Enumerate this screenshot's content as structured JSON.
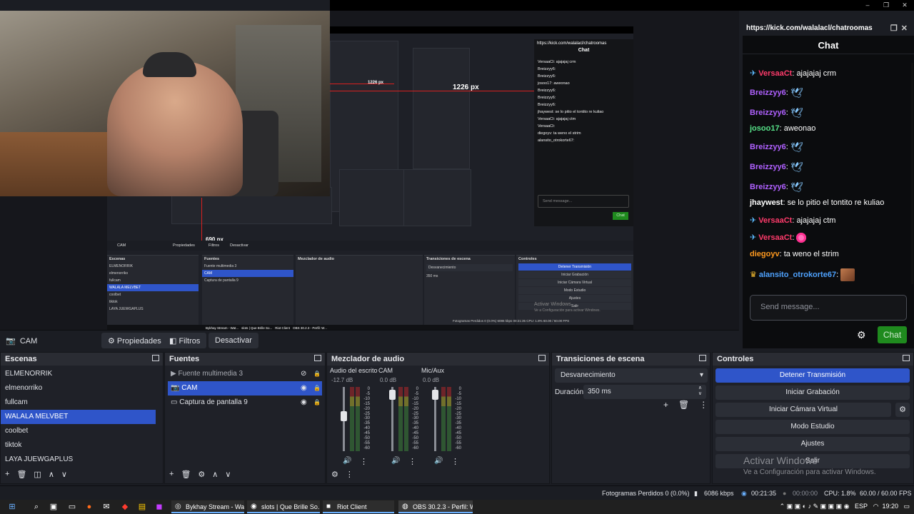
{
  "window": {
    "controls": [
      "–",
      "❐",
      "✕"
    ]
  },
  "preview_overlay": {
    "label_1226": "1226 px",
    "label_690": "690 px",
    "mini_chat_url": "https://kick.com/walalacl/chatroomas",
    "mini_chat_title": "Chat",
    "mini_lines": [
      "VersaaCt: ajajajaj crm",
      "Breizzyy6:",
      "Breizzyy6:",
      "josoo17: aweonao",
      "Breizzyy6:",
      "Breizzyy6:",
      "Breizzyy6:",
      "jhaywest: se lo pitio el tontito re kuliao",
      "VersaaCt: ajajajaj ctm",
      "VersaaCt:",
      "diegoyv: ta weno el strim",
      "alansito_otrokorte67:"
    ],
    "mini_send": "Send message...",
    "mini_chat_btn": "Chat",
    "mini_docks": [
      "Escenas",
      "Fuentes",
      "Mezclador de audio",
      "Transiciones de escena",
      "Controles"
    ],
    "mini_scenes": [
      "ELMENORRIK",
      "elmenorriko",
      "fullcam",
      "WALALA MELVBET",
      "coolbet",
      "tiktok",
      "LAYA JUEWGAPLUS"
    ],
    "mini_sources": [
      "Fuente multimedia 3",
      "CAM",
      "Captura de pantalla 9"
    ],
    "mini_controls": [
      "Detener Transmisión",
      "Iniciar Grabación",
      "Iniciar Cámara Virtual",
      "Modo Estudio",
      "Ajustes",
      "Salir"
    ],
    "mini_trans": "Desvanecimiento",
    "mini_dur": "350 ms",
    "mini_cam": "CAM",
    "mini_props": "Propiedades",
    "mini_filters": "Filtros",
    "mini_deact": "Desactivar",
    "mini_status": "Fotogramas Perdidos 0 (0.0%)   6086 kbps   00:21:35   CPU: 1.8%   60.00 / 60.00 FPS",
    "mini_watermark": "Activar Windows",
    "mini_watermark_sub": "Ve a Configuración para activar Windows.",
    "mini_tasks": [
      "Bykhay Stream - Wat...",
      "slots | Que Brille So...",
      "Riot Client",
      "OBS 30.2.3 - Perfil: W..."
    ]
  },
  "chat": {
    "url": "https://kick.com/walalacl/chatroomas",
    "title": "Chat",
    "messages": [
      {
        "user": "VersaaCt",
        "color": "#ff3b6b",
        "badge": true,
        "text": "ajajajaj crm",
        "emote": ""
      },
      {
        "user": "Breizzyy6",
        "color": "#b061ff",
        "badge": false,
        "text": "",
        "emote": "dove"
      },
      {
        "user": "Breizzyy6",
        "color": "#b061ff",
        "badge": false,
        "text": "",
        "emote": "dove"
      },
      {
        "user": "josoo17",
        "color": "#57e389",
        "badge": false,
        "text": "aweonao",
        "emote": ""
      },
      {
        "user": "Breizzyy6",
        "color": "#b061ff",
        "badge": false,
        "text": "",
        "emote": "dove"
      },
      {
        "user": "Breizzyy6",
        "color": "#b061ff",
        "badge": false,
        "text": "",
        "emote": "dove"
      },
      {
        "user": "Breizzyy6",
        "color": "#b061ff",
        "badge": false,
        "text": "",
        "emote": "dove"
      },
      {
        "user": "jhaywest",
        "color": "#ffffff",
        "badge": false,
        "text": "se lo pitio el tontito re kuliao",
        "emote": ""
      },
      {
        "user": "VersaaCt",
        "color": "#ff3b6b",
        "badge": true,
        "text": "ajajajaj ctm",
        "emote": ""
      },
      {
        "user": "VersaaCt",
        "color": "#ff3b6b",
        "badge": true,
        "text": "",
        "emote": "pink"
      },
      {
        "user": "diegoyv",
        "color": "#ff9a1f",
        "badge": false,
        "text": "ta weno el strim",
        "emote": ""
      },
      {
        "user": "alansito_otrokorte67",
        "color": "#4fa3ff",
        "badge": false,
        "crown": true,
        "text": "",
        "emote": "img"
      }
    ],
    "input_placeholder": "Send message...",
    "send_label": "Chat"
  },
  "source_toolbar": {
    "source_name": "CAM",
    "properties": "Propiedades",
    "filters": "Filtros",
    "deactivate": "Desactivar"
  },
  "docks": {
    "scenes": {
      "title": "Escenas",
      "items": [
        "ELMENORRIK",
        "elmenorriko",
        "fullcam",
        "WALALA MELVBET",
        "coolbet",
        "tiktok",
        "LAYA JUEWGAPLUS"
      ],
      "selected": 3
    },
    "sources": {
      "title": "Fuentes",
      "items": [
        {
          "name": "Fuente multimedia 3",
          "icon": "play-icon"
        },
        {
          "name": "CAM",
          "icon": "camera-icon"
        },
        {
          "name": "Captura de pantalla 9",
          "icon": "monitor-icon"
        }
      ]
    },
    "mixer": {
      "title": "Mezclador de audio",
      "channels": [
        {
          "name": "Audio del escrito",
          "db": "-12.7 dB",
          "level": 0.55
        },
        {
          "name": "CAM",
          "db": "0.0 dB",
          "level": 0.95
        },
        {
          "name": "Mic/Aux",
          "db": "0.0 dB",
          "level": 0.95
        }
      ],
      "scale": [
        "0",
        "-5",
        "-10",
        "-15",
        "-20",
        "-25",
        "-30",
        "-35",
        "-40",
        "-45",
        "-50",
        "-55",
        "-60"
      ]
    },
    "transitions": {
      "title": "Transiciones de escena",
      "selected": "Desvanecimiento",
      "duration_label": "Duración",
      "duration_value": "350 ms"
    },
    "controls": {
      "title": "Controles",
      "buttons": [
        "Detener Transmisión",
        "Iniciar Grabación",
        "Iniciar Cámara Virtual",
        "Modo Estudio",
        "Ajustes",
        "Salir"
      ]
    }
  },
  "watermark": {
    "title": "Activar Windows",
    "subtitle": "Ve a Configuración para activar Windows."
  },
  "status": {
    "dropped": "Fotogramas Perdidos 0 (0.0%)",
    "bitrate": "6086 kbps",
    "stream_time": "00:21:35",
    "rec_time": "00:00:00",
    "cpu": "CPU: 1.8%",
    "fps": "60.00 / 60.00 FPS"
  },
  "taskbar": {
    "apps": [
      {
        "label": "Bykhay Stream - Wat...",
        "icon": "chrome-icon"
      },
      {
        "label": "slots | Que Brille So...",
        "icon": "discord-icon"
      },
      {
        "label": "Riot Client",
        "icon": "riot-icon"
      },
      {
        "label": "OBS 30.2.3 - Perfil: W...",
        "icon": "obs-icon"
      }
    ],
    "lang": "ESP",
    "time": "19:20"
  }
}
